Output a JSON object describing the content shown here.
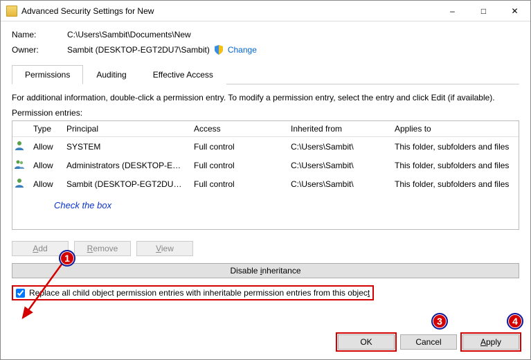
{
  "window": {
    "title": "Advanced Security Settings for New"
  },
  "fields": {
    "name_label": "Name:",
    "name_value": "C:\\Users\\Sambit\\Documents\\New",
    "owner_label": "Owner:",
    "owner_value": "Sambit (DESKTOP-EGT2DU7\\Sambit)",
    "change_link": "Change"
  },
  "tabs": {
    "permissions": "Permissions",
    "auditing": "Auditing",
    "effective": "Effective Access"
  },
  "info_text": "For additional information, double-click a permission entry. To modify a permission entry, select the entry and click Edit (if available).",
  "entries_label": "Permission entries:",
  "columns": {
    "type": "Type",
    "principal": "Principal",
    "access": "Access",
    "inherited": "Inherited from",
    "applies": "Applies to"
  },
  "rows": [
    {
      "type": "Allow",
      "principal": "SYSTEM",
      "access": "Full control",
      "inherited": "C:\\Users\\Sambit\\",
      "applies": "This folder, subfolders and files"
    },
    {
      "type": "Allow",
      "principal": "Administrators (DESKTOP-EG...",
      "access": "Full control",
      "inherited": "C:\\Users\\Sambit\\",
      "applies": "This folder, subfolders and files"
    },
    {
      "type": "Allow",
      "principal": "Sambit (DESKTOP-EGT2DU7\\S...",
      "access": "Full control",
      "inherited": "C:\\Users\\Sambit\\",
      "applies": "This folder, subfolders and files"
    }
  ],
  "annot": {
    "check_text": "Check the box",
    "b1": "1",
    "b3": "3",
    "b4": "4"
  },
  "buttons": {
    "add_pref": "A",
    "add_suf": "dd",
    "remove_pref": "R",
    "remove_suf": "emove",
    "view_pref": "V",
    "view_suf": "iew",
    "disable_pref": "Disable ",
    "disable_acc": "i",
    "disable_suf": "nheritance",
    "ok": "OK",
    "cancel": "Cancel",
    "apply_pref": "A",
    "apply_suf": "pply"
  },
  "replace": {
    "label_pref": "Replace all child object permission entries with inheritable permission entries from this objec",
    "label_acc": "t"
  }
}
